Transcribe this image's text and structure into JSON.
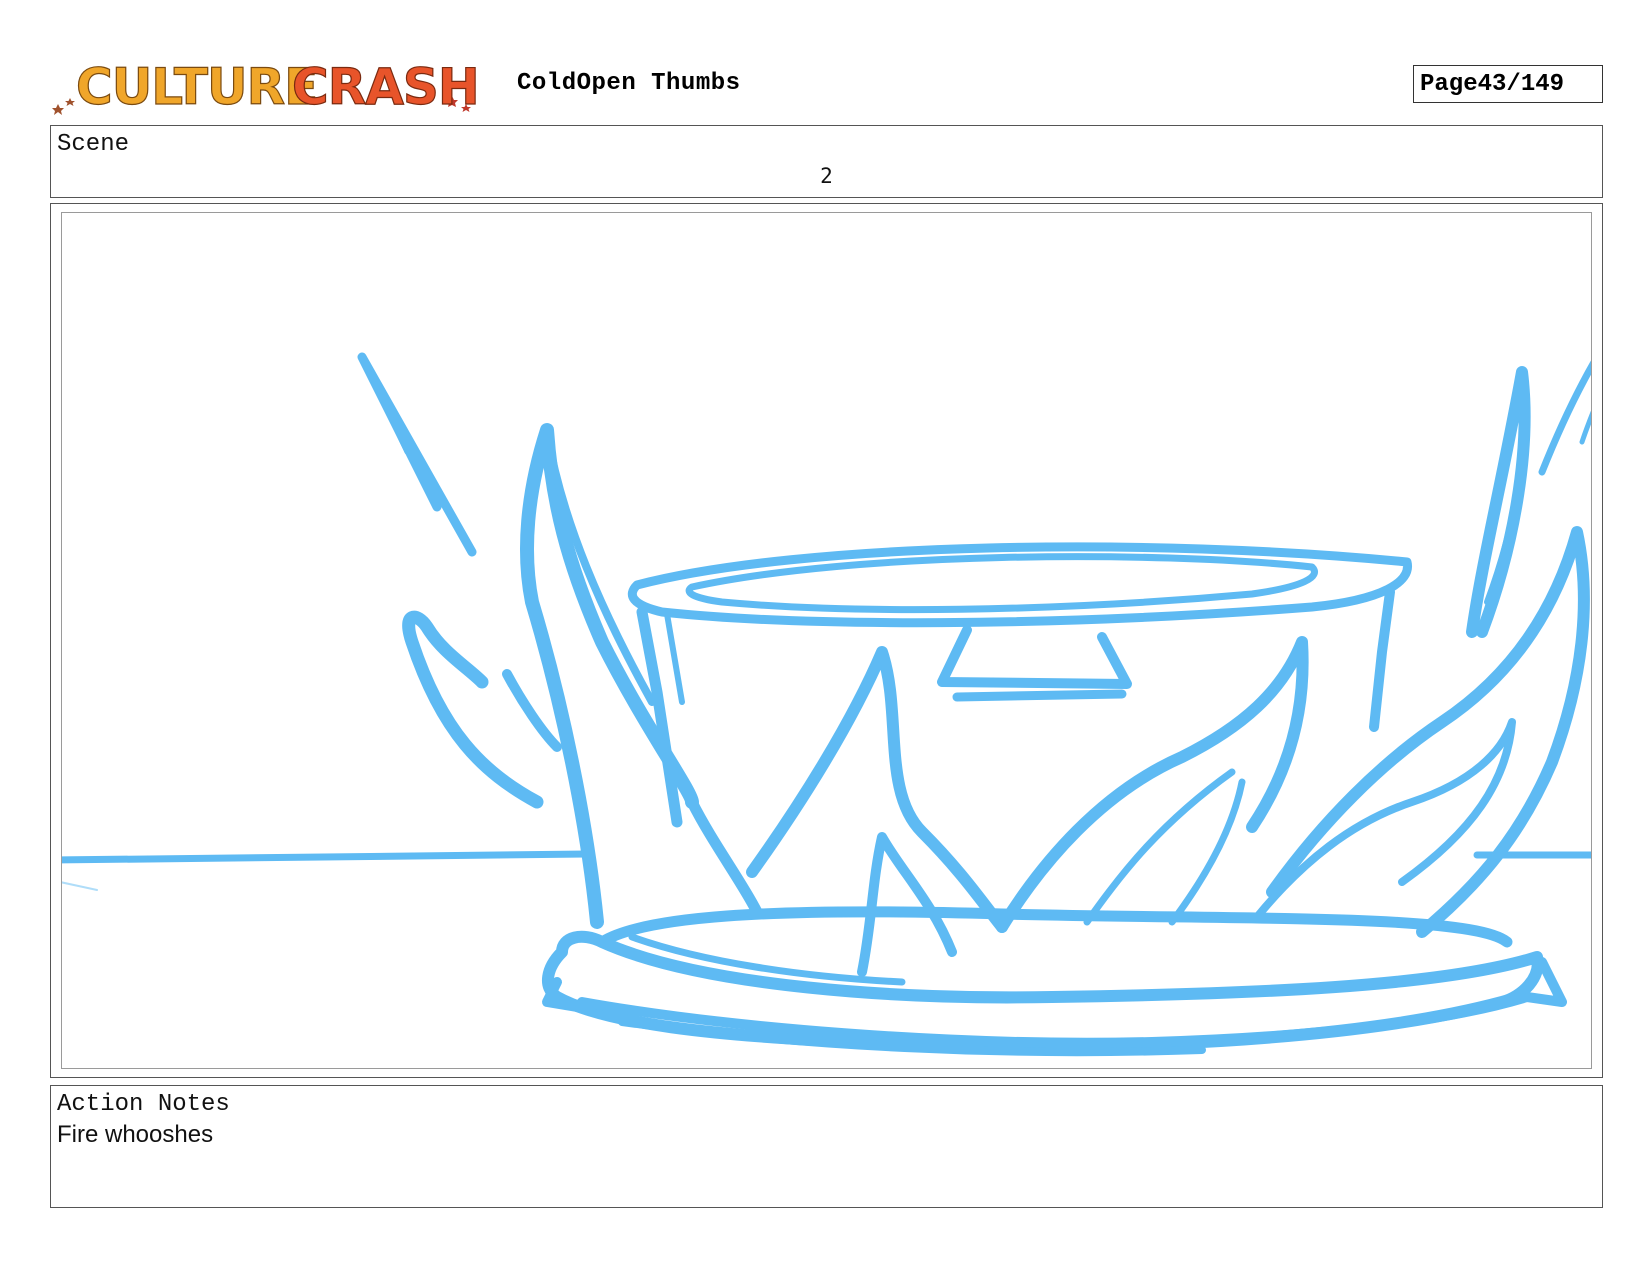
{
  "header": {
    "logo_text": "CULTURE CRASH",
    "title": "ColdOpen Thumbs",
    "page_label": "Page",
    "page_number": "43/149"
  },
  "scene": {
    "label": "Scene",
    "number": "2"
  },
  "panel": {
    "stroke_color": "#4db3f2"
  },
  "action_notes": {
    "label": "Action Notes",
    "text": "Fire whooshes"
  }
}
